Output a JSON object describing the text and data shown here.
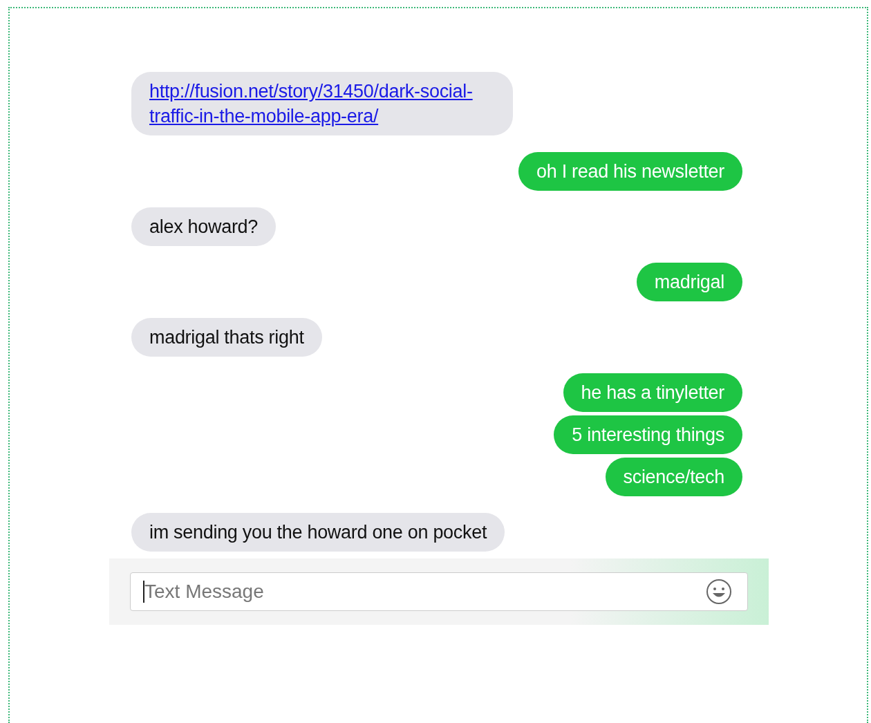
{
  "messages": [
    {
      "kind": "link",
      "outgoing": false,
      "text": "http://fusion.net/story/31450/dark-social-traffic-in-the-mobile-app-era/"
    },
    {
      "kind": "text",
      "outgoing": true,
      "text": "oh I read his newsletter"
    },
    {
      "kind": "text",
      "outgoing": false,
      "text": "alex howard?"
    },
    {
      "kind": "text",
      "outgoing": true,
      "text": "madrigal"
    },
    {
      "kind": "text",
      "outgoing": false,
      "text": "madrigal thats right"
    },
    {
      "kind": "text",
      "outgoing": true,
      "text": "he has a tinyletter"
    },
    {
      "kind": "text",
      "outgoing": true,
      "text": "5 interesting things"
    },
    {
      "kind": "text",
      "outgoing": true,
      "text": "science/tech"
    },
    {
      "kind": "text",
      "outgoing": false,
      "text": "im sending you the howard one on pocket"
    }
  ],
  "composer": {
    "placeholder": "Text Message"
  }
}
